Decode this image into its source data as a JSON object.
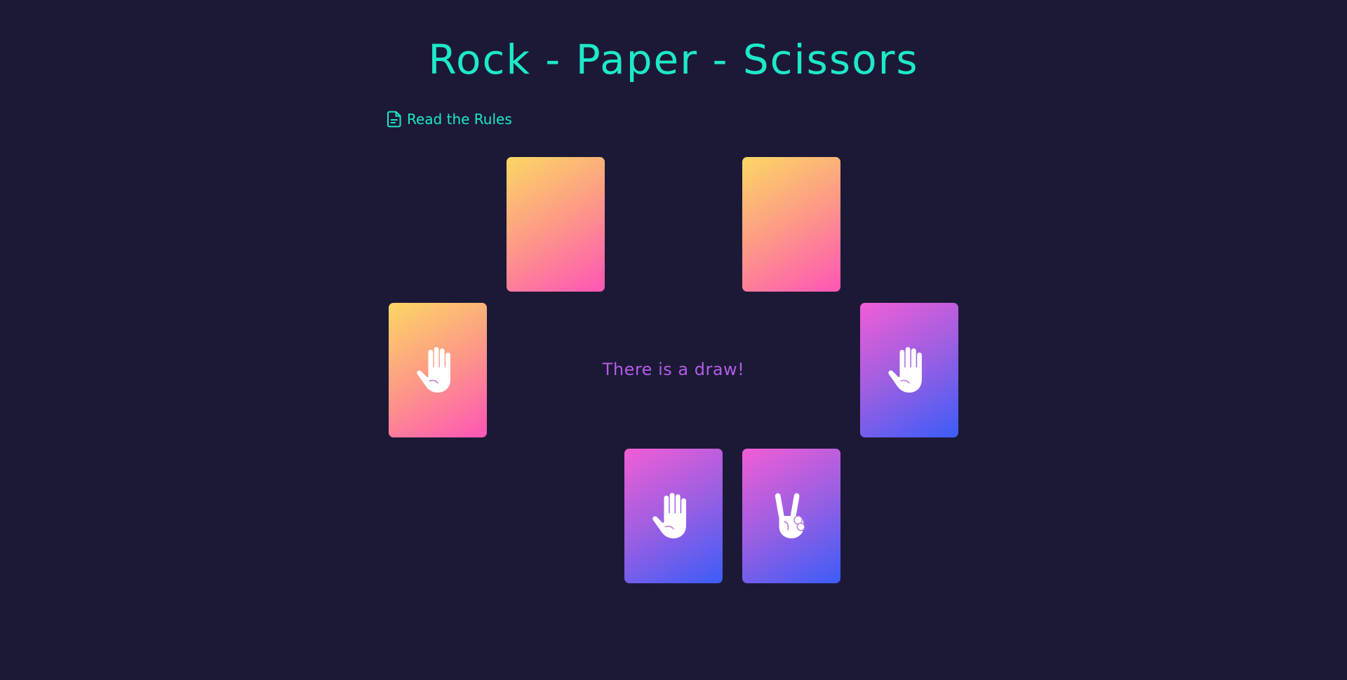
{
  "header": {
    "title": "Rock - Paper - Scissors"
  },
  "rules_link": {
    "label": "Read the Rules",
    "icon": "document-icon"
  },
  "status": {
    "message": "There is a draw!"
  },
  "cards": {
    "top_left": {
      "face": "hidden"
    },
    "top_right": {
      "face": "hidden"
    },
    "middle_left": {
      "face": "paper",
      "icon": "paper-hand-icon"
    },
    "middle_right": {
      "face": "paper",
      "icon": "paper-hand-icon"
    },
    "bottom_left": {
      "face": "paper",
      "icon": "paper-hand-icon"
    },
    "bottom_right": {
      "face": "scissors",
      "icon": "scissors-hand-icon"
    }
  },
  "colors": {
    "background": "#1c1936",
    "accent": "#1de9c8",
    "status_text": "#b25de6",
    "warm_gradient": [
      "#fbd763",
      "#fd9b85",
      "#fe55b6"
    ],
    "cool_gradient": [
      "#f25dd6",
      "#9a5fe2",
      "#3b5cf9"
    ]
  }
}
